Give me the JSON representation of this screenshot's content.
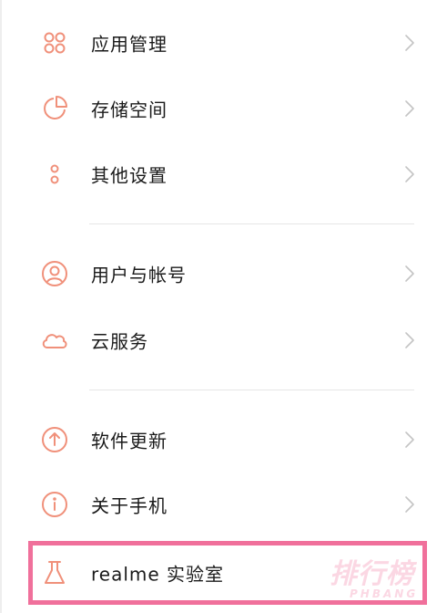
{
  "settings": {
    "items": [
      {
        "label": "应用管理",
        "icon": "apps-grid-icon"
      },
      {
        "label": "存储空间",
        "icon": "storage-pie-icon"
      },
      {
        "label": "其他设置",
        "icon": "more-settings-icon"
      },
      {
        "label": "用户与帐号",
        "icon": "user-account-icon"
      },
      {
        "label": "云服务",
        "icon": "cloud-icon"
      },
      {
        "label": "软件更新",
        "icon": "update-arrow-icon"
      },
      {
        "label": "关于手机",
        "icon": "info-icon"
      },
      {
        "label": "realme 实验室",
        "icon": "lab-flask-icon"
      }
    ]
  },
  "watermark": {
    "main": "排行榜",
    "sub": "PHBANG"
  },
  "colors": {
    "accent_icon": "#f0907a",
    "highlight": "#f0709b",
    "chevron": "#c4c4c4",
    "divider": "#e6e6e6",
    "text": "#1a1a1a"
  }
}
